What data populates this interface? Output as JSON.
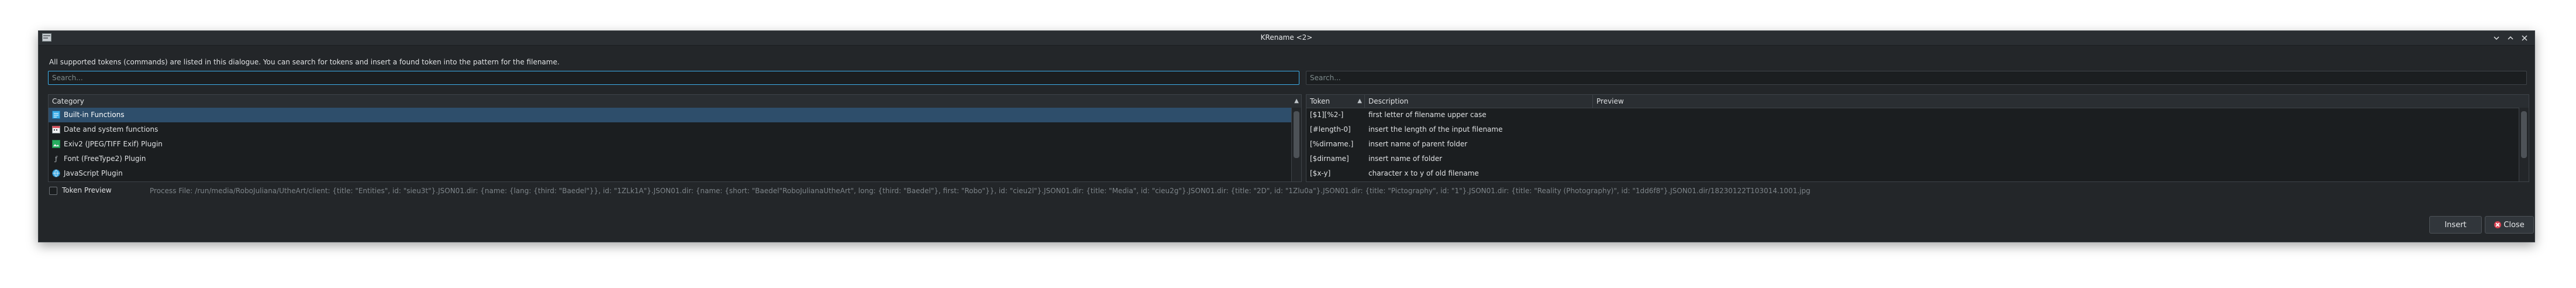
{
  "window": {
    "title": "KRename <2>"
  },
  "intro_text": "All supported tokens (commands) are listed in this dialogue. You can search for tokens and insert a found token into the pattern for the filename.",
  "search_left": {
    "placeholder": "Search..."
  },
  "search_right": {
    "placeholder": "Search..."
  },
  "categories": {
    "header": "Category",
    "items": [
      {
        "label": "Built-in Functions",
        "icon": "grid-icon"
      },
      {
        "label": "Date and system functions",
        "icon": "calendar-icon"
      },
      {
        "label": "Exiv2 (JPEG/TIFF Exif) Plugin",
        "icon": "image-icon"
      },
      {
        "label": "Font (FreeType2) Plugin",
        "icon": "font-icon"
      },
      {
        "label": "JavaScript Plugin",
        "icon": "globe-icon"
      }
    ],
    "selected_index": 0
  },
  "tokens": {
    "headers": {
      "token": "Token",
      "description": "Description",
      "preview": "Preview"
    },
    "rows": [
      {
        "token": "[$1][%2-]",
        "description": "first letter of filename upper case"
      },
      {
        "token": "[#length-0]",
        "description": "insert the length of the input filename"
      },
      {
        "token": "[%dirname.]",
        "description": "insert name of parent folder"
      },
      {
        "token": "[$dirname]",
        "description": "insert name of folder"
      },
      {
        "token": "[$x-y]",
        "description": "character x to y of old filename"
      }
    ]
  },
  "token_preview": {
    "label": "Token Preview",
    "text": "Process File: /run/media/RoboJuliana/UtheArt/client: {title: \"Entities\", id: \"sieu3t\"}.JSON01.dir: {name: {lang: {third: \"Baedel\"}}, id: \"1ZLk1A\"}.JSON01.dir: {name: {short: \"Baedel\"RoboJulianaUtheArt\", long: {third: \"Baedel\"}, first: \"Robo\"}}, id: \"cieu2l\"}.JSON01.dir: {title: \"Media\", id: \"cieu2g\"}.JSON01.dir: {title: \"2D\", id: \"1Zlu0a\"}.JSON01.dir: {title: \"Pictography\", id: \"1\"}.JSON01.dir: {title: \"Reality (Photography)\", id: \"1dd6f8\"}.JSON01.dir/18230122T103014.1001.jpg"
  },
  "buttons": {
    "insert": "Insert",
    "close": "Close"
  },
  "colors": {
    "accent": "#3daee9",
    "selection": "#2e4e6b",
    "close_icon": "#da4453"
  }
}
